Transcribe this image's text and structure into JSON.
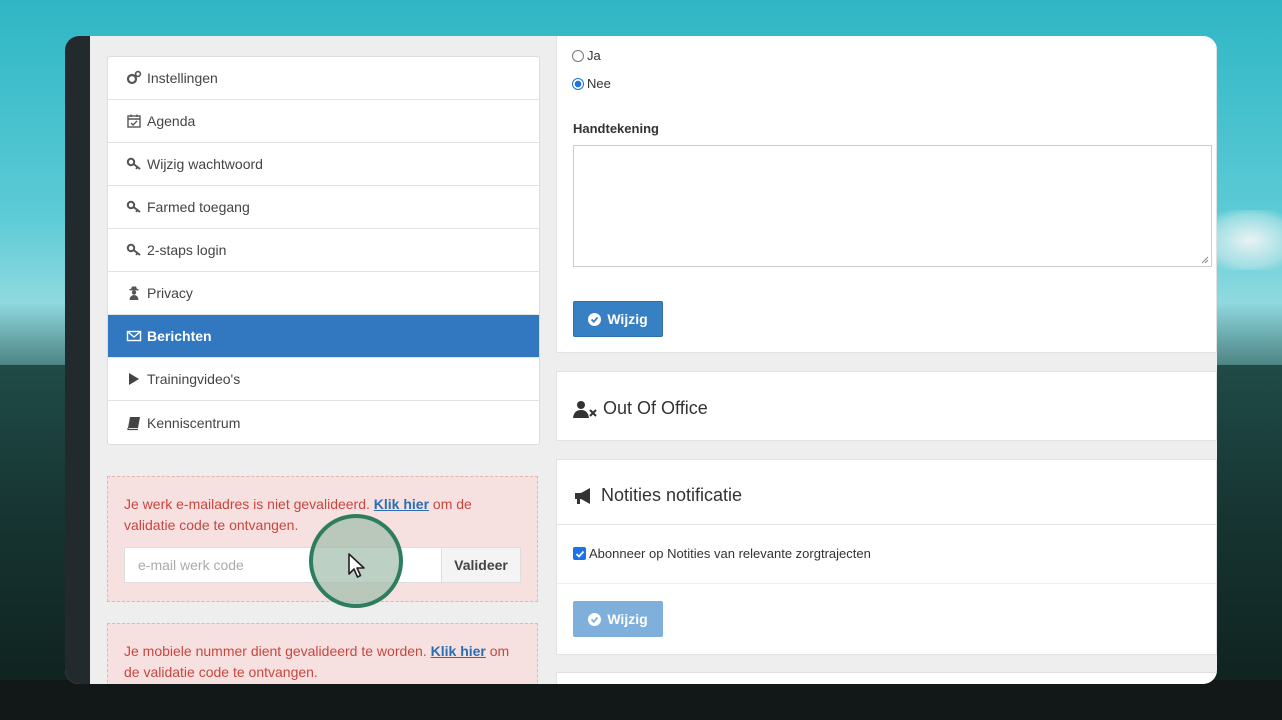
{
  "sidebar": {
    "items": [
      {
        "label": "Instellingen",
        "icon": "gears-icon"
      },
      {
        "label": "Agenda",
        "icon": "calendar-check-icon"
      },
      {
        "label": "Wijzig wachtwoord",
        "icon": "key-icon"
      },
      {
        "label": "Farmed toegang",
        "icon": "key-icon"
      },
      {
        "label": "2-staps login",
        "icon": "key-icon"
      },
      {
        "label": "Privacy",
        "icon": "user-secret-icon"
      },
      {
        "label": "Berichten",
        "icon": "envelope-icon",
        "active": true
      },
      {
        "label": "Trainingvideo's",
        "icon": "play-icon"
      },
      {
        "label": "Kenniscentrum",
        "icon": "book-icon"
      }
    ]
  },
  "email_alert": {
    "text_before": "Je werk e-mailadres is niet gevalideerd.",
    "link": "Klik hier",
    "text_after": "om de validatie code te ontvangen.",
    "input_placeholder": "e-mail werk code",
    "button": "Valideer"
  },
  "mobile_alert": {
    "text_before": "Je mobiele nummer dient gevalideerd te worden.",
    "link": "Klik hier",
    "text_after": "om de validatie code te ontvangen."
  },
  "top_panel": {
    "radio_options": [
      {
        "label": "Ja",
        "checked": false
      },
      {
        "label": "Nee",
        "checked": true
      }
    ],
    "signature_label": "Handtekening",
    "save_button": "Wijzig"
  },
  "ooo_panel": {
    "title": "Out Of Office"
  },
  "notif_panel": {
    "title": "Notities notificatie",
    "checkbox_label": "Abonneer op Notities van relevante zorgtrajecten",
    "checkbox_checked": true,
    "save_button": "Wijzig"
  },
  "colors": {
    "active_menu": "#3178c0",
    "primary_button": "#3880c4",
    "alert_text": "#c9463f",
    "alert_bg": "#f6e1e0",
    "cursor_ring": "#2e7d5e"
  }
}
